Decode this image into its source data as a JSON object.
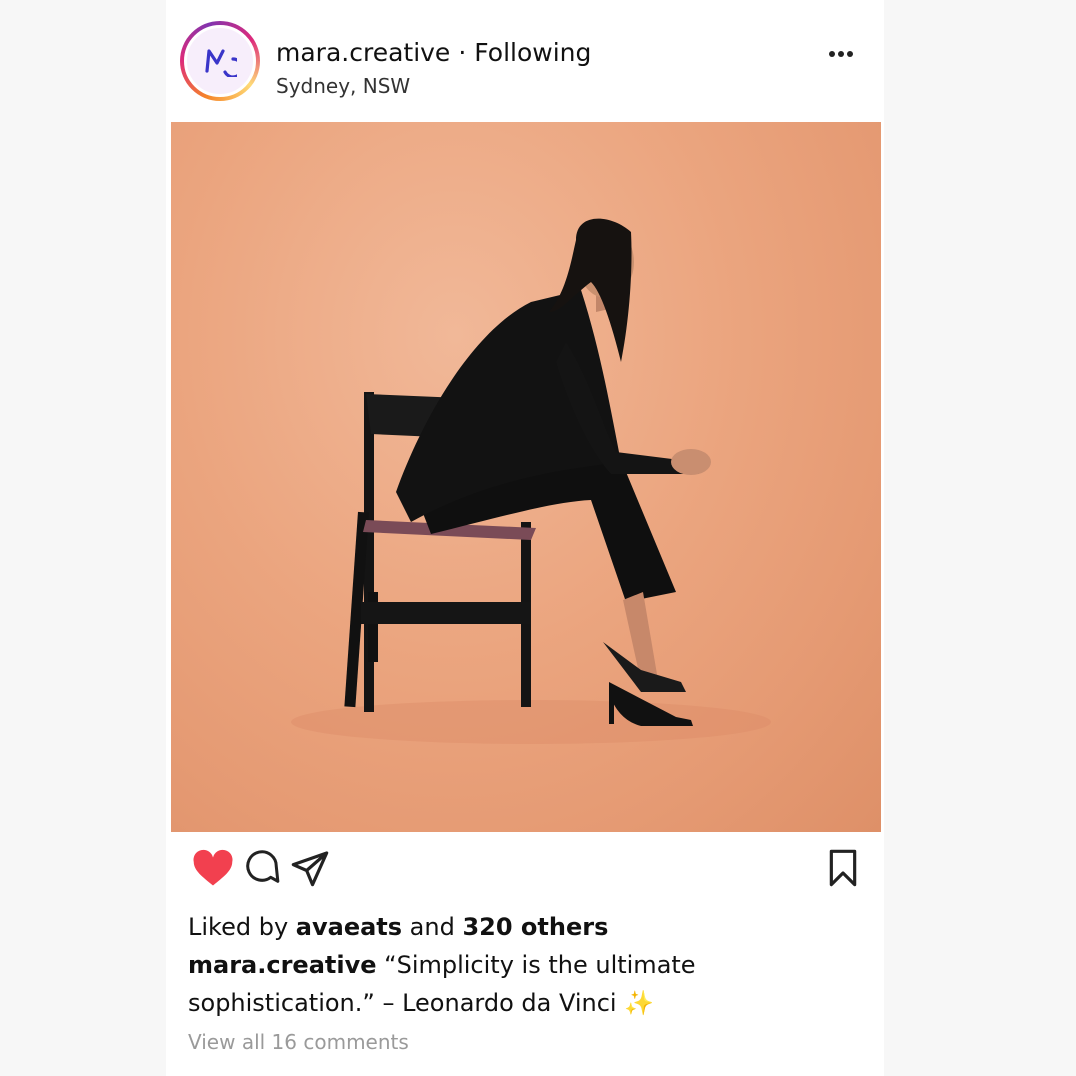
{
  "post": {
    "username": "mara.creative",
    "separator": "·",
    "follow_status": "Following",
    "location": "Sydney, NSW",
    "avatar_initials": "MC",
    "icons": {
      "more": "more-horizontal-icon",
      "like": "heart-filled-icon",
      "comment": "comment-bubble-icon",
      "share": "paper-plane-icon",
      "save": "bookmark-icon"
    },
    "colors": {
      "like": "#f2404f",
      "background_photo": "#eba57f",
      "muted_text": "#9a9a9a"
    }
  },
  "engagement": {
    "liked_prefix": "Liked by ",
    "liked_user": "avaeats",
    "liked_and": " and ",
    "liked_others": "320 others"
  },
  "caption": {
    "author": "mara.creative",
    "text": " “Simplicity is the ultimate sophistication.” – Leonardo da Vinci ",
    "emoji": "✨"
  },
  "comments_link": "View all 16 comments"
}
